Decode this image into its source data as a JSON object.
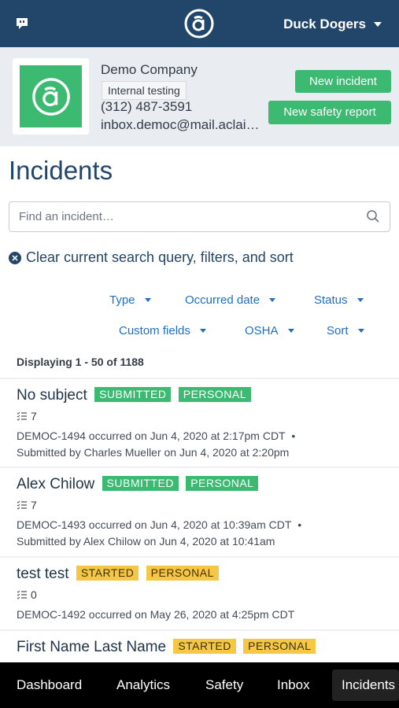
{
  "header": {
    "chat_icon": "chat-bubble-icon",
    "logo_icon": "at-sign-logo",
    "user_name": "Duck Dogers"
  },
  "company": {
    "name": "Demo Company",
    "tag": "Internal testing",
    "phone": "(312) 487-3591",
    "email": "inbox.democ@mail.aclaimant.com",
    "new_incident_label": "New incident",
    "new_safety_label": "New safety report",
    "accent_color": "#3dba72"
  },
  "page": {
    "title": "Incidents"
  },
  "search": {
    "placeholder": "Find an incident…",
    "value": ""
  },
  "clear_label": "Clear current search query, filters, and sort",
  "filters": {
    "type": "Type",
    "occurred_date": "Occurred date",
    "status": "Status",
    "custom_fields": "Custom fields",
    "osha": "OSHA",
    "sort": "Sort"
  },
  "displaying": "Displaying 1 - 50 of 1188",
  "incidents": [
    {
      "subject": "No subject",
      "status": "SUBMITTED",
      "category": "PERSONAL",
      "tasks": "7",
      "occurred": "DEMOC-1494 occurred on Jun 4, 2020 at 2:17pm CDT",
      "submitted": "Submitted by Charles Mueller on Jun 4, 2020 at 2:20pm"
    },
    {
      "subject": "Alex Chilow",
      "status": "SUBMITTED",
      "category": "PERSONAL",
      "tasks": "7",
      "occurred": "DEMOC-1493 occurred on Jun 4, 2020 at 10:39am CDT",
      "submitted": "Submitted by Alex Chilow on Jun 4, 2020 at 10:41am"
    },
    {
      "subject": "test test",
      "status": "STARTED",
      "category": "PERSONAL",
      "tasks": "0",
      "occurred": "DEMOC-1492 occurred on May 26, 2020 at 4:25pm CDT",
      "submitted": ""
    },
    {
      "subject": "First Name Last Name",
      "status": "STARTED",
      "category": "PERSONAL",
      "tasks": "",
      "occurred": "",
      "submitted": ""
    }
  ],
  "bullet": "•",
  "bottom_nav": {
    "dashboard": "Dashboard",
    "analytics": "Analytics",
    "safety": "Safety",
    "inbox": "Inbox",
    "incidents": "Incidents"
  }
}
